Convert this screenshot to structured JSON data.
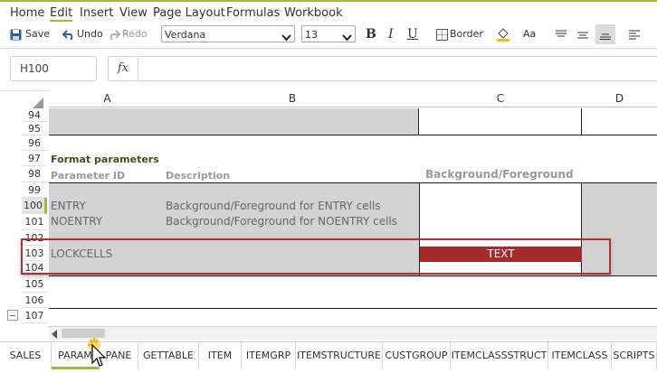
{
  "menu": {
    "items": [
      "Home",
      "Edit",
      "Insert",
      "View",
      "Page Layout",
      "Formulas",
      "Workbook"
    ],
    "active_index": 1
  },
  "toolbar": {
    "save_label": "Save",
    "undo_label": "Undo",
    "redo_label": "Redo",
    "font_family": "Verdana",
    "font_size": "13",
    "bold_label": "B",
    "italic_label": "I",
    "underline_label": "U",
    "border_label": "Border",
    "case_label": "Aa"
  },
  "formula_bar": {
    "cell_ref": "H100",
    "fx_label": "fx",
    "formula": ""
  },
  "columns": [
    "A",
    "B",
    "C",
    "D"
  ],
  "rows": [
    "94",
    "95",
    "96",
    "97",
    "98",
    "99",
    "100",
    "101",
    "102",
    "103",
    "104",
    "105",
    "106",
    "107"
  ],
  "selected_row": "100",
  "cells": {
    "section_title": "Format parameters",
    "param_id_header": "Parameter ID",
    "description_header": "Description",
    "bg_fg_header": "Background/Foreground",
    "entry": "ENTRY",
    "entry_desc": "Background/Foreground for ENTRY cells",
    "noentry": "NOENTRY",
    "noentry_desc": "Background/Foreground for NOENTRY cells",
    "lockcells": "LOCKCELLS",
    "lockcells_sample": "TEXT"
  },
  "colors": {
    "accent": "#9bbb3c",
    "grey_fill": "#d3d3d3",
    "lock_red": "#a52a2a",
    "highlight_border": "#b03030"
  },
  "sheet_tabs": {
    "items": [
      "SALES",
      "PARAM",
      "PANE",
      "GETTABLE",
      "ITEM",
      "ITEMGRP",
      "ITEMSTRUCTURE",
      "CUSTGROUP",
      "ITEMCLASSSTRUCT",
      "ITEMCLASS",
      "SCRIPTS"
    ],
    "active_index": 1
  },
  "icons": {
    "save": "save-disk-icon",
    "undo": "undo-arrow-icon",
    "redo": "redo-arrow-icon",
    "border": "border-grid-icon",
    "fill": "fill-bucket-icon",
    "align": "align-lines-icon",
    "cursor": "mouse-pointer-icon"
  }
}
